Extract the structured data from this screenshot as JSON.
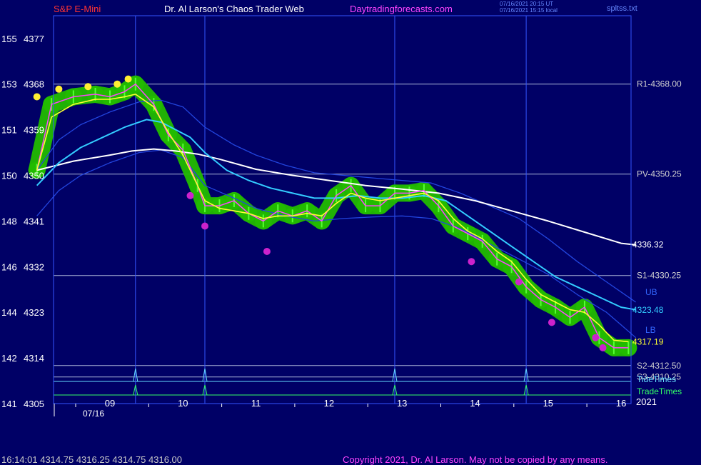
{
  "header": {
    "instrument": "S&P E-Mini",
    "site": "Dr. Al Larson's Chaos Trader Web",
    "url": "Daytradingforecasts.com",
    "time_utc": "07/16/2021 20:15 UT",
    "time_local": "07/16/2021 15:15 local",
    "file": "spltss.txt"
  },
  "footer": {
    "quote": "16:14:01  4314.75 4316.25 4314.75 4316.00",
    "copyright": "Copyright 2021, Dr. Al Larson. May not be copied by any means."
  },
  "colors": {
    "background": "#000066",
    "frame": "#3355ff",
    "price": "#ff44ff",
    "ma_fast": "#ffff33",
    "ma_mid": "#33ccff",
    "ma_slow": "#ffffff",
    "band": "#2244dd",
    "halo": "#22bb00",
    "level": "#aab4d8",
    "tide": "#66ddff",
    "trade": "#33ff66",
    "copyright": "#ff44ff"
  },
  "chart_data": {
    "type": "line",
    "xlabel": "",
    "ylabel": "",
    "ylim": [
      4305,
      4381
    ],
    "x_ticks": [
      "09",
      "10",
      "11",
      "12",
      "13",
      "14",
      "15",
      "16"
    ],
    "x_sub": [
      "07/16",
      "2021"
    ],
    "y_ticks": [
      {
        "left": "155",
        "price": "4377",
        "v": 4377
      },
      {
        "left": "153",
        "price": "4368",
        "v": 4368
      },
      {
        "left": "151",
        "price": "4359",
        "v": 4359
      },
      {
        "left": "150",
        "price": "4350",
        "v": 4350
      },
      {
        "left": "148",
        "price": "4341",
        "v": 4341
      },
      {
        "left": "146",
        "price": "4332",
        "v": 4332
      },
      {
        "left": "144",
        "price": "4323",
        "v": 4323
      },
      {
        "left": "142",
        "price": "4314",
        "v": 4314
      },
      {
        "left": "141",
        "price": "4305",
        "v": 4305
      }
    ],
    "levels": [
      {
        "label": "R1-4368.00",
        "v": 4368.0
      },
      {
        "label": "PV-4350.25",
        "v": 4350.25
      },
      {
        "label": "S1-4330.25",
        "v": 4330.25
      },
      {
        "label": "S2-4312.50",
        "v": 4312.5
      },
      {
        "label": "S3-4310.25",
        "v": 4310.25
      }
    ],
    "price_labels": [
      {
        "label": "4336.32",
        "v": 4336.32
      },
      {
        "label": "4323.48",
        "v": 4323.48
      },
      {
        "label": "4317.19",
        "v": 4317.19
      }
    ],
    "band_labels": [
      "UB",
      "LB"
    ],
    "time_lines": [
      "9.35",
      "10.3",
      "12.9",
      "14.7"
    ],
    "tide_label": "TideTimes",
    "trade_label": "TradeTimes",
    "series": [
      {
        "key": "price",
        "x": [
          8.0,
          8.2,
          8.5,
          8.8,
          9.0,
          9.2,
          9.35,
          9.6,
          9.8,
          10.0,
          10.2,
          10.3,
          10.5,
          10.7,
          10.9,
          11.1,
          11.3,
          11.5,
          11.7,
          11.9,
          12.1,
          12.3,
          12.5,
          12.7,
          12.9,
          13.1,
          13.3,
          13.5,
          13.7,
          13.9,
          14.1,
          14.3,
          14.5,
          14.7,
          14.9,
          15.1,
          15.3,
          15.5,
          15.7,
          15.9,
          16.1
        ],
        "y": [
          4351,
          4364,
          4365.5,
          4366,
          4365.5,
          4366.5,
          4368,
          4364,
          4358,
          4355,
          4348,
          4344,
          4344,
          4345,
          4342.5,
          4341,
          4343,
          4342,
          4343,
          4341,
          4346,
          4348,
          4344,
          4344,
          4346.5,
          4346.5,
          4347,
          4344,
          4340,
          4338.5,
          4337,
          4333.5,
          4332,
          4328,
          4325.5,
          4324,
          4322,
          4324,
          4318,
          4316,
          4316
        ]
      },
      {
        "key": "ma_fast",
        "x": [
          8.0,
          8.2,
          8.5,
          8.8,
          9.0,
          9.2,
          9.35,
          9.6,
          9.8,
          10.0,
          10.2,
          10.3,
          10.5,
          10.7,
          10.9,
          11.1,
          11.3,
          11.5,
          11.7,
          11.9,
          12.1,
          12.3,
          12.5,
          12.7,
          12.9,
          13.1,
          13.3,
          13.5,
          13.7,
          13.9,
          14.1,
          14.3,
          14.5,
          14.7,
          14.9,
          15.1,
          15.3,
          15.5,
          15.7,
          15.9,
          16.1
        ],
        "y": [
          4351,
          4361.5,
          4364,
          4365,
          4365,
          4365.5,
          4366,
          4363.5,
          4358.5,
          4354,
          4348,
          4345,
          4343.5,
          4343,
          4342.5,
          4341.5,
          4342,
          4342,
          4342.5,
          4342,
          4344.5,
          4346.5,
          4345.5,
          4345,
          4345.5,
          4346,
          4346.5,
          4345,
          4341.5,
          4339,
          4337.5,
          4335,
          4333,
          4329.5,
          4326.5,
          4325,
          4323.5,
          4323,
          4320.5,
          4317.5,
          4317.2
        ]
      },
      {
        "key": "ma_mid",
        "x": [
          8.0,
          8.3,
          8.6,
          8.9,
          9.2,
          9.5,
          9.7,
          9.9,
          10.1,
          10.3,
          10.6,
          10.9,
          11.2,
          11.5,
          11.8,
          12.1,
          12.4,
          12.7,
          13.0,
          13.3,
          13.6,
          13.9,
          14.2,
          14.5,
          14.8,
          15.1,
          15.4,
          15.7,
          16.0,
          16.2
        ],
        "y": [
          4348,
          4352.5,
          4355.5,
          4357.5,
          4359.5,
          4361,
          4360.5,
          4359,
          4357.5,
          4354.5,
          4351,
          4349,
          4347.5,
          4346.5,
          4345.5,
          4345.5,
          4346,
          4345.5,
          4345.5,
          4346,
          4345,
          4342,
          4339,
          4336,
          4333,
          4330,
          4328,
          4326,
          4324,
          4323.5
        ]
      },
      {
        "key": "ma_slow",
        "x": [
          8.0,
          8.5,
          9.0,
          9.3,
          9.6,
          9.9,
          10.2,
          10.5,
          11.0,
          11.5,
          12.0,
          12.5,
          13.0,
          13.5,
          14.0,
          14.5,
          15.0,
          15.5,
          16.0,
          16.2
        ],
        "y": [
          4351,
          4352.8,
          4354,
          4354.8,
          4355.2,
          4354.8,
          4354.2,
          4353.2,
          4351.2,
          4350,
          4349,
          4348,
          4347.3,
          4346.5,
          4345,
          4343,
          4341,
          4338.8,
          4336.6,
          4336.3
        ]
      },
      {
        "key": "band_upper",
        "x": [
          8.0,
          8.3,
          8.6,
          9.0,
          9.4,
          9.7,
          10.0,
          10.3,
          10.7,
          11.0,
          11.4,
          11.8,
          12.2,
          12.6,
          13.0,
          13.4,
          13.8,
          14.2,
          14.6,
          15.0,
          15.4,
          15.8,
          16.0,
          16.2
        ],
        "y": [
          4351,
          4357,
          4360,
          4362.5,
          4364.5,
          4364.8,
          4363.5,
          4359.5,
          4356,
          4354,
          4352,
          4350.5,
          4350,
          4349.5,
          4349,
          4348.5,
          4346.5,
          4344,
          4341.5,
          4337.5,
          4333,
          4329,
          4327,
          4325
        ]
      },
      {
        "key": "band_lower",
        "x": [
          8.0,
          8.3,
          8.6,
          9.0,
          9.4,
          9.7,
          10.0,
          10.3,
          10.7,
          11.0,
          11.4,
          11.8,
          12.2,
          12.6,
          13.0,
          13.4,
          13.8,
          14.2,
          14.6,
          15.0,
          15.4,
          15.8,
          16.0,
          16.2
        ],
        "y": [
          4342,
          4347,
          4350,
          4352.5,
          4354.5,
          4355,
          4353.5,
          4348,
          4345.5,
          4343.5,
          4342,
          4341,
          4341.5,
          4341.8,
          4342,
          4341.5,
          4339.5,
          4336.5,
          4333.5,
          4330.5,
          4326.5,
          4323,
          4320.5,
          4318
        ]
      }
    ]
  }
}
